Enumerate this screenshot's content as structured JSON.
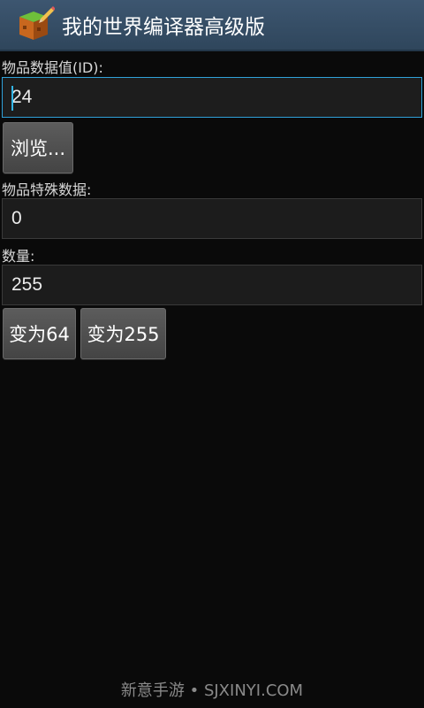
{
  "header": {
    "app_icon": "minecraft-block-pencil-icon",
    "title": "我的世界编译器高级版"
  },
  "item_id": {
    "label": "物品数据值(ID):",
    "value": "24"
  },
  "browse_button": {
    "label": "浏览..."
  },
  "special_data": {
    "label": "物品特殊数据:",
    "value": "0"
  },
  "quantity": {
    "label": "数量:",
    "value": "255"
  },
  "quantity_buttons": {
    "set_64": "变为64",
    "set_255": "变为255"
  },
  "watermark": "新意手游 • SJXINYI.COM",
  "colors": {
    "actionbar": "#354e66",
    "focus": "#33b5e5",
    "background": "#0a0a0a"
  }
}
